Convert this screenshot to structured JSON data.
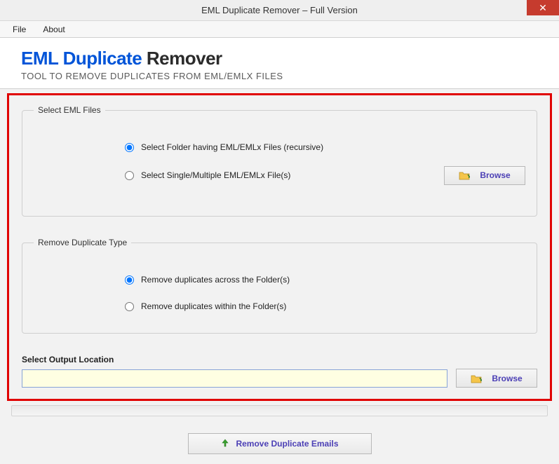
{
  "titlebar": {
    "title": "EML Duplicate Remover – Full Version"
  },
  "menubar": {
    "file": "File",
    "about": "About"
  },
  "branding": {
    "part1": "EML Duplicate ",
    "part2": "Remover",
    "subtitle": "TOOL TO REMOVE DUPLICATES FROM EML/EMLX FILES"
  },
  "select_files": {
    "legend": "Select EML Files",
    "option1": "Select Folder having EML/EMLx Files (recursive)",
    "option2": "Select Single/Multiple EML/EMLx File(s)",
    "browse": "Browse"
  },
  "dup_type": {
    "legend": "Remove Duplicate Type",
    "option1": "Remove duplicates across the Folder(s)",
    "option2": "Remove duplicates within the Folder(s)"
  },
  "output": {
    "label": "Select  Output Location",
    "value": "",
    "browse": "Browse"
  },
  "footer": {
    "remove": "Remove Duplicate Emails"
  }
}
